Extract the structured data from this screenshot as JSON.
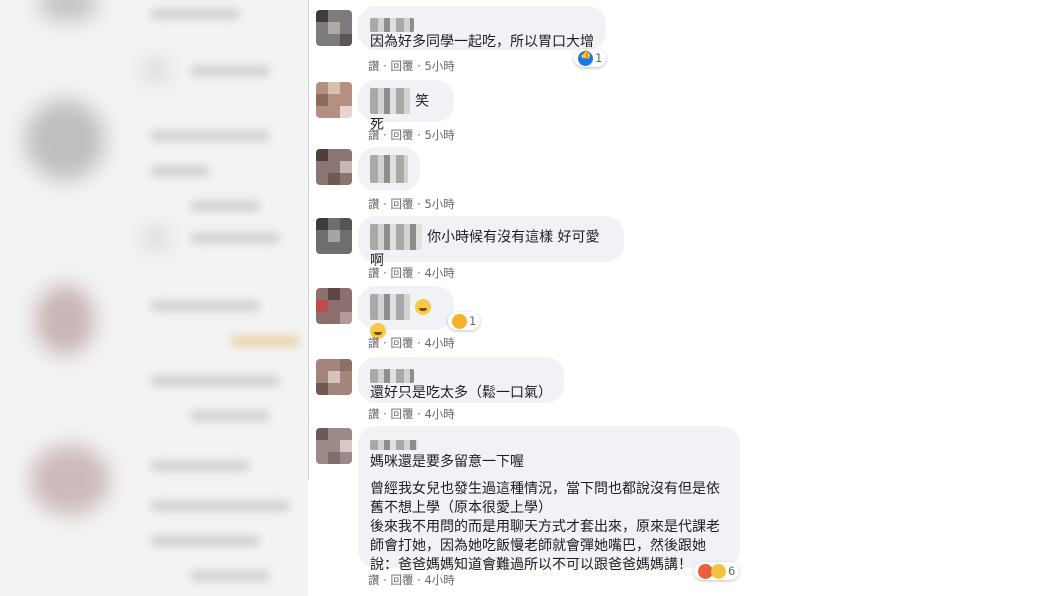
{
  "comments": [
    {
      "text": "因為好多同學一起吃，所以胃口大增",
      "like": "讚",
      "reply": "回覆",
      "sep": "·",
      "time": "5小時",
      "reaction_count": "1"
    },
    {
      "text": "笑死",
      "like": "讚",
      "reply": "回覆",
      "sep": "·",
      "time": "5小時"
    },
    {
      "text": "",
      "like": "讚",
      "reply": "回覆",
      "sep": "·",
      "time": "5小時"
    },
    {
      "text": "你小時候有沒有這樣 好可愛啊",
      "like": "讚",
      "reply": "回覆",
      "sep": "·",
      "time": "4小時"
    },
    {
      "text": "",
      "like": "讚",
      "reply": "回覆",
      "sep": "·",
      "time": "4小時",
      "reaction_count": "1"
    },
    {
      "text": "還好只是吃太多（鬆一口氣）",
      "like": "讚",
      "reply": "回覆",
      "sep": "·",
      "time": "4小時"
    },
    {
      "text": "媽咪還是要多留意一下喔",
      "body": "曾經我女兒也發生過這種情況，當下問也都說沒有但是依\n舊不想上學（原本很愛上學）\n後來我不用問的而是用聊天方式才套出來，原來是代課老\n師會打她，因為她吃飯慢老師就會彈她嘴巴，然後跟她\n說：爸爸媽媽知道會難過所以不可以跟爸爸媽媽講！",
      "like": "讚",
      "reply": "回覆",
      "sep": "·",
      "time": "4小時",
      "reaction_count": "6"
    }
  ],
  "colors": {
    "bubble": "#f0f2f5",
    "meta": "#65676b",
    "like_blue": "#1877f2"
  }
}
